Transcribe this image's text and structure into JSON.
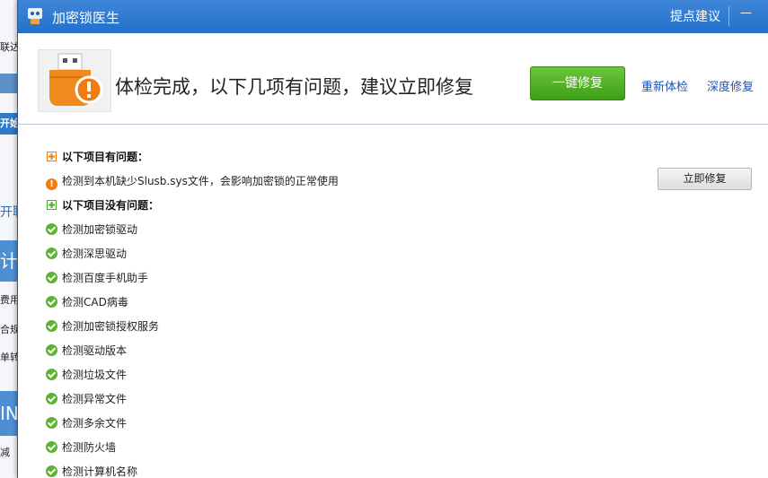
{
  "background_app": {
    "fragments": [
      "联达",
      "开始",
      "开联",
      "计位",
      "费用",
      "合规",
      "单转",
      "IN",
      "减"
    ]
  },
  "window": {
    "title": "加密锁医生",
    "feedback_label": "提点建议",
    "minimize_glyph": "—",
    "headline": "体检完成，以下几项有问题，建议立即修复",
    "fix_all_label": "一键修复",
    "recheck_label": "重新体检",
    "deep_check_label": "深度修复"
  },
  "problems": {
    "heading": "以下项目有问题：",
    "items": [
      {
        "text": "检测到本机缺少Slusb.sys文件，会影响加密锁的正常使用",
        "action": "立即修复"
      }
    ]
  },
  "no_problems": {
    "heading": "以下项目没有问题：",
    "items": [
      "检测加密锁驱动",
      "检测深思驱动",
      "检测百度手机助手",
      "检测CAD病毒",
      "检测加密锁授权服务",
      "检测驱动版本",
      "检测垃圾文件",
      "检测异常文件",
      "检测多余文件",
      "检测防火墙",
      "检测计算机名称"
    ]
  },
  "colors": {
    "title_bar": "#2f7bd0",
    "accent_green": "#4caf22",
    "warning_orange": "#f27a12",
    "link_blue": "#1a52b5"
  }
}
